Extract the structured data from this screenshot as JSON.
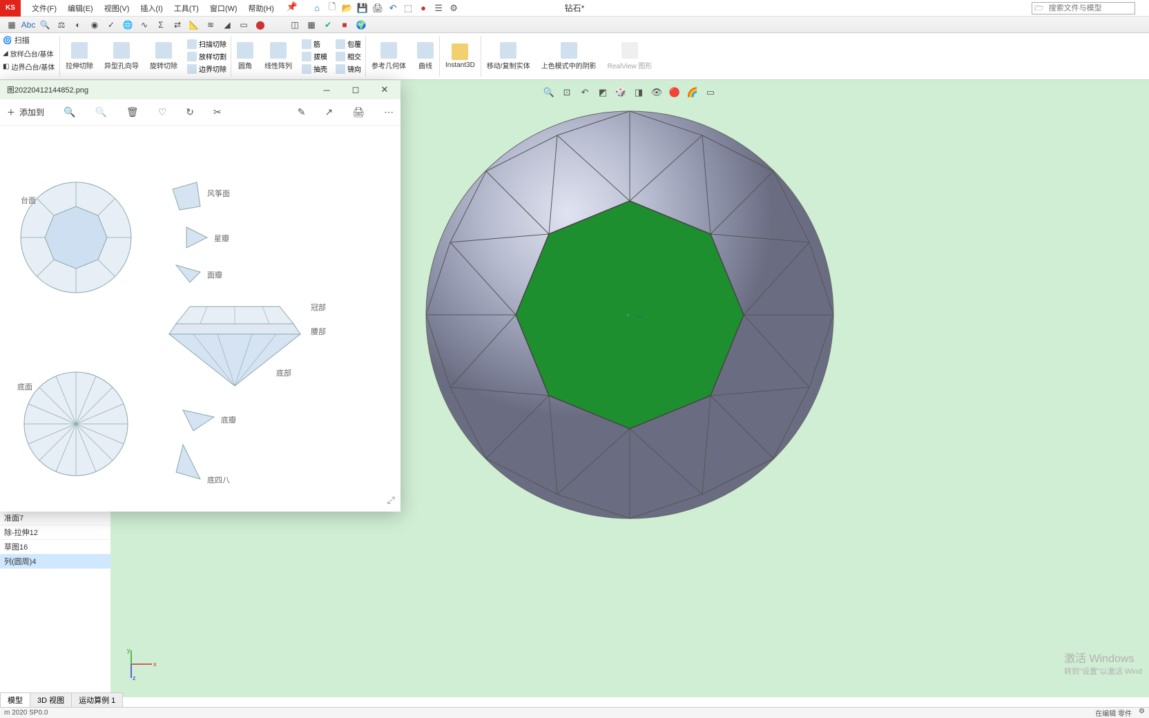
{
  "app": {
    "logo": "KS",
    "title": "钻石*"
  },
  "menu": {
    "file": "文件(F)",
    "edit": "编辑(E)",
    "view": "视图(V)",
    "insert": "插入(I)",
    "tools": "工具(T)",
    "window": "窗口(W)",
    "help": "帮助(H)"
  },
  "search": {
    "placeholder": "搜索文件与模型"
  },
  "ribbon_side": {
    "scan": "扫描",
    "loft": "放样凸台/基体",
    "boundary": "边界凸台/基体"
  },
  "ribbon": {
    "extrude_cut": "拉伸切除",
    "wizard": "异型孔向导",
    "revolve_cut": "旋转切除",
    "scan_cut": "扫描切除",
    "loft_cut": "放样切割",
    "boundary_cut": "边界切除",
    "fillet": "圆角",
    "linear_pattern": "线性阵列",
    "rib": "筋",
    "draft": "拔模",
    "shell": "抽壳",
    "wrap": "包覆",
    "intersect": "相交",
    "mirror": "镜向",
    "ref_geom": "参考几何体",
    "curve": "曲线",
    "instant": "Instant3D",
    "move_copy": "移动/复制实体",
    "display_shadow": "上色模式中的阴影",
    "realview": "RealView 图形"
  },
  "photos": {
    "filename": "图20220412144852.png",
    "add_to": "添加到",
    "labels": {
      "table": "台面",
      "kite": "风筝面",
      "star": "星瓣",
      "facet": "面瓣",
      "crown": "冠部",
      "girdle": "腰部",
      "pavilion": "底部",
      "culet": "底面",
      "lower": "底瓣",
      "lower48": "底四八"
    }
  },
  "tree": {
    "i1": "准面7",
    "i2": "除-拉伸12",
    "i3": "草图16",
    "i4": "列(圆周)4"
  },
  "tabs": {
    "model": "模型",
    "view3d": "3D 视图",
    "motion": "运动算例 1"
  },
  "status": {
    "version": "m 2020 SP0.0",
    "editing": "在编辑 零件"
  },
  "watermark": {
    "l1": "激活 Windows",
    "l2": "转到\"设置\"以激活 Wind"
  }
}
